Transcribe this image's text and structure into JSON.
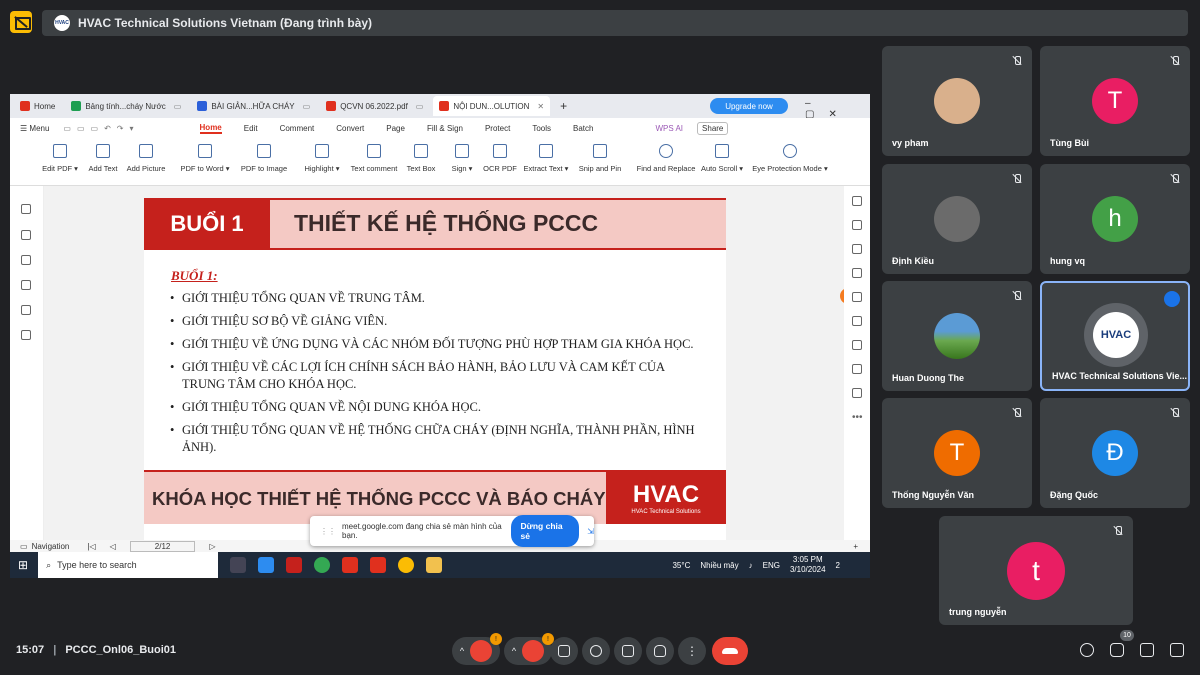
{
  "meet": {
    "presenting_title": "HVAC Technical Solutions Vietnam (Đang trình bày)",
    "time": "15:07",
    "separator": "|",
    "meeting_code": "PCCC_Onl06_Buoi01",
    "participant_count": "10",
    "mic_badge": "!",
    "cam_badge": "!"
  },
  "participants": [
    {
      "name": "vy pham",
      "avatar": "photo-woman"
    },
    {
      "name": "Tùng Bùi",
      "initial": "T",
      "color": "#e91e63"
    },
    {
      "name": "Định Kiều",
      "avatar": "photo-man"
    },
    {
      "name": "hung vq",
      "initial": "h",
      "color": "#43a047"
    },
    {
      "name": "Huan Duong The",
      "avatar": "photo-landscape"
    },
    {
      "name": "HVAC Technical Solutions Vie...",
      "initial": "HVAC",
      "color": "#ffffff"
    },
    {
      "name": "Thống Nguyễn Văn",
      "initial": "T",
      "color": "#ef6c00"
    },
    {
      "name": "Đặng Quốc",
      "initial": "Đ",
      "color": "#1e88e5"
    },
    {
      "name": "trung nguyễn",
      "initial": "t",
      "color": "#e91e63"
    }
  ],
  "wps": {
    "tabs": [
      {
        "label": "Home",
        "color": "#e0301e"
      },
      {
        "label": "Bảng tính...cháy Nước",
        "color": "#1e9e52"
      },
      {
        "label": "BÀI GIẢN...HỮA CHÁY",
        "color": "#2b5fd9"
      },
      {
        "label": "QCVN 06.2022.pdf",
        "color": "#e0301e"
      },
      {
        "label": "NỘI DUN...OLUTION",
        "color": "#e0301e"
      }
    ],
    "upgrade": "Upgrade now",
    "menu_label": "Menu",
    "menu": [
      "Home",
      "Edit",
      "Comment",
      "Convert",
      "Page",
      "Fill & Sign",
      "Protect",
      "Tools",
      "Batch"
    ],
    "wps_ai": "WPS AI",
    "share": "Share",
    "tools": [
      "Edit PDF ▾",
      "Add Text",
      "Add Picture",
      "PDF to Word ▾",
      "PDF to Image",
      "Highlight ▾",
      "Text comment",
      "Text Box",
      "Sign ▾",
      "OCR PDF",
      "Extract Text ▾",
      "Snip and Pin",
      "Find and Replace",
      "Auto Scroll ▾",
      "Eye Protection Mode ▾"
    ],
    "navigation": "Navigation",
    "page_indicator": "2/12",
    "zoom": "+"
  },
  "slide": {
    "session": "BUỔI 1",
    "title": "THIẾT KẾ HỆ THỐNG PCCC",
    "subtitle": "BUỔI 1:",
    "bullets": [
      "GIỚI THIỆU TỔNG QUAN VỀ TRUNG TÂM.",
      "GIỚI THIỆU SƠ BỘ VỀ GIẢNG VIÊN.",
      "GIỚI THIỆU VỀ ỨNG DỤNG VÀ CÁC NHÓM ĐỐI TƯỢNG PHÙ HỢP THAM GIA KHÓA HỌC.",
      "GIỚI THIỆU VỀ CÁC LỢI ÍCH CHÍNH SÁCH BẢO HÀNH, BẢO LƯU VÀ CAM KẾT CỦA TRUNG TÂM CHO KHÓA HỌC.",
      "GIỚI THIỆU TỔNG QUAN VỀ NỘI DUNG KHÓA HỌC.",
      "GIỚI THIỆU TỔNG QUAN VỀ HỆ THỐNG CHỮA CHÁY (ĐỊNH NGHĨA, THÀNH PHẦN, HÌNH ẢNH)."
    ],
    "footer": "KHÓA HỌC THIẾT HỆ THỐNG PCCC VÀ BÁO CHÁY",
    "logo": "HVAC",
    "logo_sub": "HVAC Technical Solutions"
  },
  "share_notice": {
    "text": "meet.google.com đang chia sẻ màn hình của bạn.",
    "stop": "Dừng chia sẻ"
  },
  "taskbar": {
    "search": "Type here to search",
    "temp": "35°C",
    "weather": "Nhiều mây",
    "lang": "ENG",
    "time": "3:05 PM",
    "date": "3/10/2024",
    "notif": "2"
  }
}
